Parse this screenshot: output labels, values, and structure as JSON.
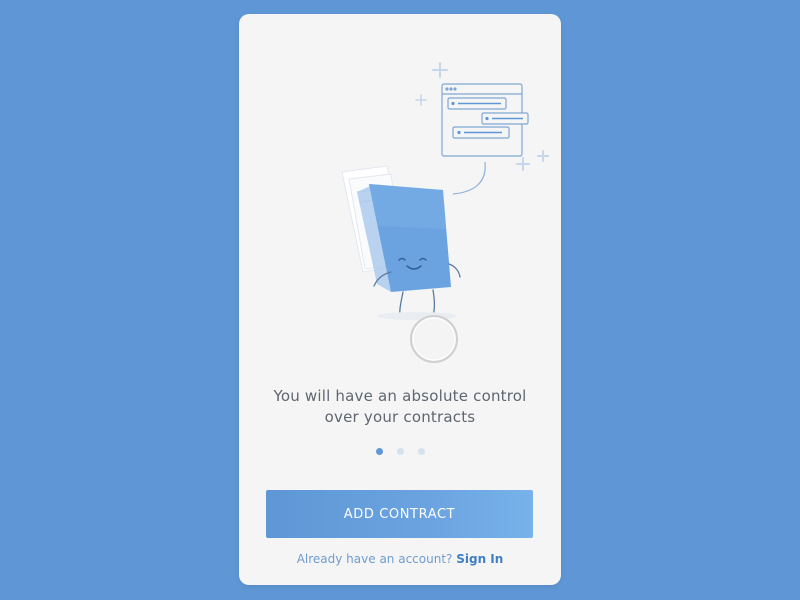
{
  "onboarding": {
    "headline_line1": "You will have an absolute control",
    "headline_line2": "over your contracts",
    "page_count": 3,
    "current_page": 1
  },
  "actions": {
    "add_contract_label": "ADD CONTRACT",
    "account_prompt": "Already have an account?",
    "sign_in_label": "Sign In"
  },
  "colors": {
    "background": "#5f97d6",
    "card": "#f5f5f5",
    "accent": "#5f97d6",
    "text": "#5f6670",
    "link": "#3f7fc6"
  },
  "icons": [
    "plus-sparkle-icon",
    "contract-window-icon",
    "contract-document-character-icon",
    "tap-indicator-icon"
  ]
}
